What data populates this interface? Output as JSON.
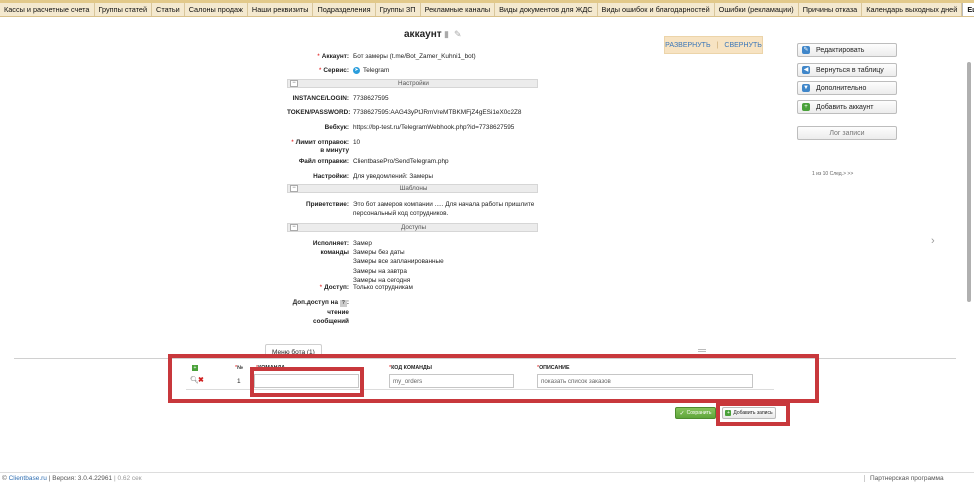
{
  "tabs": [
    "Кассы и расчетные счета",
    "Группы статей",
    "Статьи",
    "Салоны продаж",
    "Наши реквизиты",
    "Подразделения",
    "Группы ЗП",
    "Рекламные каналы",
    "Виды документов для ЖДС",
    "Виды ошибок и благодарностей",
    "Ошибки (рекламации)",
    "Причины отказа",
    "Календарь выходных дней",
    "Еще"
  ],
  "page": {
    "title": "аккаунт"
  },
  "expand": {
    "expand_label": "РАЗВЕРНУТЬ",
    "divider": "|",
    "collapse_label": "СВЕРНУТЬ"
  },
  "side_buttons": {
    "edit": "Редактировать",
    "back": "Вернуться в таблицу",
    "more": "Дополнительно",
    "add": "Добавить аккаунт",
    "log": "Лог записи"
  },
  "pager": "1 из 10 След.> >>",
  "fields": {
    "account_label": "Аккаунт:",
    "account_value": "Бот замеры (t.me/Bot_Zamer_Kuhni1_bot)",
    "service_label": "Сервис:",
    "service_value": "Telegram",
    "section_settings": "Настройки",
    "login_label": "INSTANCE/LOGIN:",
    "login_value": "7738627595",
    "token_label": "TOKEN/PASSWORD:",
    "token_value": "7738627595:AAG43yPtJRmVreMTBKMFjZ4gESi1eX0c2Z8",
    "webhook_label": "Вебхук:",
    "webhook_value": "https://bp-test.ru/TelegramWebhook.php?id=7738627595",
    "limit_label_1": "Лимит отправок",
    "limit_label_2": "в минуту",
    "limit_value": "10",
    "file_label": "Файл отправки:",
    "file_value": "ClientbasePro/SendTelegram.php",
    "settings_label": "Настройки:",
    "settings_value": "Для уведомлений: Замеры",
    "section_templates": "Шаблоны",
    "greeting_label": "Приветствие:",
    "greeting_value_1": "Это бот замеров компании ..... Для начала работы пришлите",
    "greeting_value_2": "персональный код сотрудников.",
    "section_access": "Доступы",
    "executor_label_1": "Исполняет",
    "executor_label_2": "команды",
    "commands": [
      "Замер",
      "Замеры без даты",
      "Замеры все запланированные",
      "Замеры на завтра",
      "Замеры на сегодня"
    ],
    "access_label": "Доступ:",
    "access_value": "Только сотрудникам",
    "extra_label_1": "Доп.доступ на",
    "extra_label_2": "чтение",
    "extra_label_3": "сообщений",
    "extra_help": "?"
  },
  "subtable": {
    "tab_label": "Меню бота (1)",
    "col_num": "№",
    "col_command": "КОМАНДА",
    "col_code": "КОД КОМАНДЫ",
    "col_desc": "ОПИСАНИЕ",
    "row_num": "1",
    "row_command": "",
    "row_code": "my_orders",
    "row_desc": "показать список заказов",
    "save_label": "Сохранить",
    "add_label": "Добавить запись"
  },
  "footer": {
    "brand": "Clientbase.ru",
    "version": "| Версия: 3.0.4.22961",
    "time": "| 0.62 сек",
    "partner": "Партнерская программа"
  },
  "colors": {
    "accent": "#3a76b8",
    "highlight": "#c8383c",
    "save": "#5fa53a"
  }
}
